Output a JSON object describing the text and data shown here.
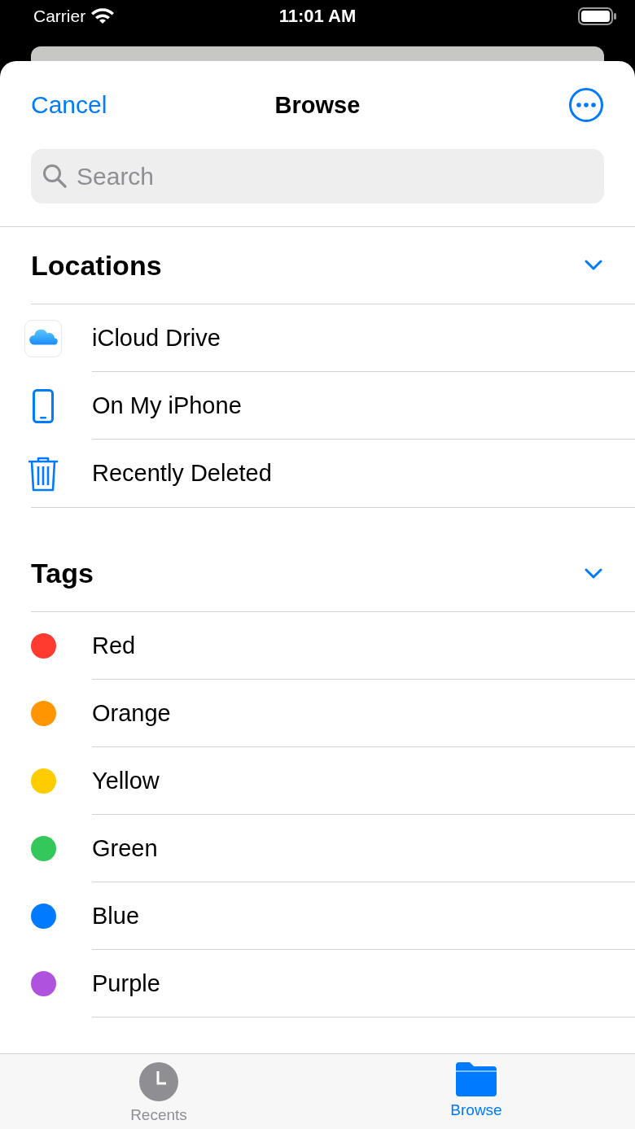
{
  "status_bar": {
    "carrier": "Carrier",
    "time": "11:01 AM"
  },
  "header": {
    "cancel": "Cancel",
    "title": "Browse"
  },
  "search": {
    "placeholder": "Search"
  },
  "locations": {
    "title": "Locations",
    "items": [
      {
        "label": "iCloud Drive",
        "kind": "icloud"
      },
      {
        "label": "On My iPhone",
        "kind": "phone"
      },
      {
        "label": "Recently Deleted",
        "kind": "trash"
      }
    ]
  },
  "tags": {
    "title": "Tags",
    "items": [
      {
        "label": "Red",
        "color": "#ff3b30"
      },
      {
        "label": "Orange",
        "color": "#ff9500"
      },
      {
        "label": "Yellow",
        "color": "#ffcc00"
      },
      {
        "label": "Green",
        "color": "#34c759"
      },
      {
        "label": "Blue",
        "color": "#007aff"
      },
      {
        "label": "Purple",
        "color": "#af52de"
      }
    ]
  },
  "tab_bar": [
    {
      "label": "Recents",
      "kind": "recents",
      "selected": false
    },
    {
      "label": "Browse",
      "kind": "browse",
      "selected": true
    }
  ]
}
